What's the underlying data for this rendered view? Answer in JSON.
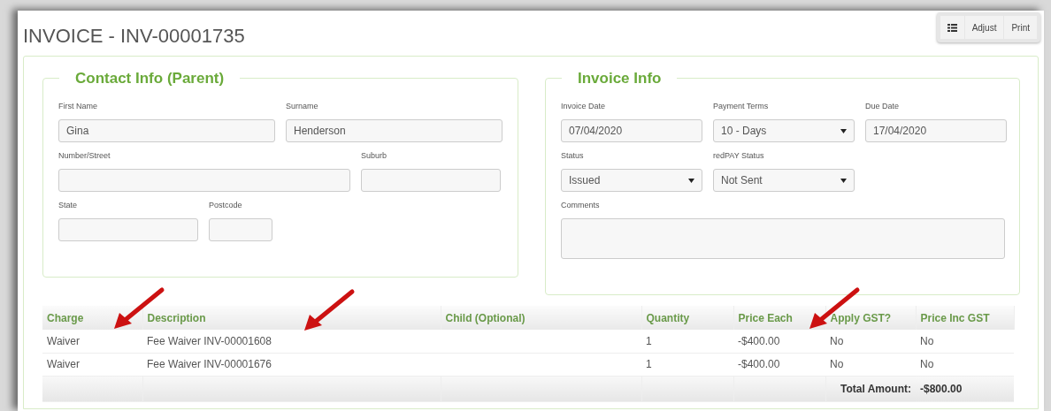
{
  "title": "INVOICE - INV-00001735",
  "toolbar": [
    {
      "kind": "icon"
    },
    {
      "kind": "text",
      "label": "Adjust"
    },
    {
      "kind": "text",
      "label": "Print"
    }
  ],
  "sections": [
    {
      "legend": "Contact Info (Parent)",
      "rows": [
        [
          {
            "label": "First Name",
            "kind": "text",
            "value": "Gina"
          },
          {
            "label": "Surname",
            "kind": "text",
            "value": "Henderson"
          }
        ],
        [
          {
            "label": "Number/Street",
            "kind": "text"
          },
          {
            "label": "Suburb",
            "kind": "text"
          }
        ],
        [
          {
            "label": "State",
            "kind": "text"
          },
          {
            "label": "Postcode",
            "kind": "text"
          }
        ]
      ]
    },
    {
      "legend": "Invoice Info",
      "rows": [
        [
          {
            "label": "Invoice Date",
            "kind": "text",
            "value": "07/04/2020"
          },
          {
            "label": "Payment Terms",
            "kind": "select",
            "value": "10 - Days"
          },
          {
            "label": "Due Date",
            "kind": "text",
            "value": "17/04/2020"
          }
        ],
        [
          {
            "label": "Status",
            "kind": "select",
            "value": "Issued"
          },
          {
            "label": "redPAY Status",
            "kind": "select",
            "value": "Not Sent"
          }
        ],
        [
          {
            "label": "Comments",
            "kind": "textarea"
          }
        ]
      ]
    }
  ],
  "table": {
    "columns": [
      "Charge",
      "Description",
      "Child (Optional)",
      "Quantity",
      "Price Each",
      "Apply GST?",
      "Price Inc GST"
    ],
    "rows": [
      [
        "Waiver",
        "Fee Waiver INV-00001608",
        "",
        "1",
        "-$400.00",
        "No",
        "No"
      ],
      [
        "Waiver",
        "Fee Waiver INV-00001676",
        "",
        "1",
        "-$400.00",
        "No",
        "No"
      ]
    ],
    "total_label": "Total Amount:",
    "total_value": "-$800.00"
  }
}
